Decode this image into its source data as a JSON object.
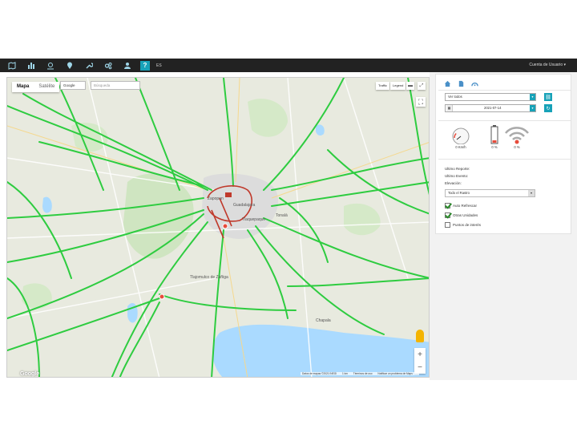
{
  "topbar": {
    "icons": [
      "map-icon",
      "reports-icon",
      "location-pin-icon",
      "marker-icon",
      "wrench-icon",
      "gears-icon",
      "users-icon"
    ],
    "help_label": "?",
    "language": "ES",
    "account_label": "Cuenta de Usuario ▾"
  },
  "map": {
    "type_active": "Mapa",
    "type_inactive": "Satélite",
    "provider": "Google",
    "search_placeholder": "Búsqueda",
    "traffic_label": "Traffic",
    "legend_label": "Legend",
    "fullscreen_icon": "fullscreen-icon",
    "zoom_in": "+",
    "zoom_out": "−",
    "google_mark": "Google",
    "attribution": [
      "Datos de mapas ©2021 INEGI",
      "1 km",
      "Términos de uso",
      "Notificar un problema de Maps"
    ],
    "cities": [
      "Zapopan",
      "Guadalajara",
      "Tlaquepaque",
      "Tonalá",
      "Tlajomulco de Zúñiga",
      "Chapala"
    ],
    "colors": {
      "land": "#e8eadf",
      "green_area": "#cfe5c1",
      "lake": "#aadaff",
      "traffic": "#2ecc40",
      "urban": "#dcdcdc",
      "congestion": "#c0392b"
    }
  },
  "panel": {
    "tab_icons": [
      "home-icon",
      "document-icon",
      "dashboard-icon"
    ],
    "vehicle_select": "Ver todos",
    "date_value": "2021-07-14",
    "speed_value": "0 Km/h",
    "battery_value": "0 %",
    "signal_value": "0 %",
    "fields": {
      "last_report": "Ultimo Reporte:",
      "last_event": "Ultimo Evento:",
      "elevation": "Elevación:"
    },
    "path_select": "Todo el Rastro",
    "checkboxes": [
      {
        "label": "Auto Refrescar",
        "checked": true
      },
      {
        "label": "Otras Unidades",
        "checked": true
      },
      {
        "label": "Puntos de interés",
        "checked": false
      }
    ],
    "accent": "#17a2b8"
  }
}
